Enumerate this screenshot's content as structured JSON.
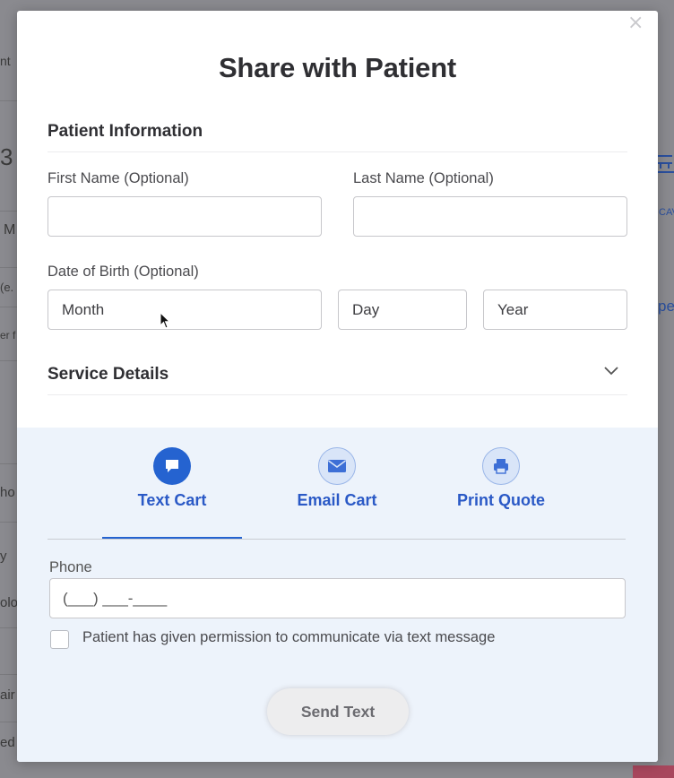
{
  "background": {
    "fragments": [
      "nt",
      "3",
      "M",
      "(e.",
      "er f",
      "ho",
      "y",
      "olo",
      "air",
      "ed",
      "pe",
      "CAV"
    ]
  },
  "modal": {
    "title": "Share with Patient",
    "close_symbol": "×",
    "patient_info": {
      "heading": "Patient Information",
      "first_name": {
        "label": "First Name (Optional)",
        "value": ""
      },
      "last_name": {
        "label": "Last Name (Optional)",
        "value": ""
      },
      "dob": {
        "label": "Date of Birth (Optional)",
        "month": "Month",
        "day": "Day",
        "year": "Year"
      }
    },
    "service_details": {
      "heading": "Service Details",
      "expand_icon": "chevron-down-icon"
    },
    "share": {
      "tabs": [
        {
          "label": "Text Cart",
          "icon": "chat-bubble-icon",
          "active": true
        },
        {
          "label": "Email Cart",
          "icon": "envelope-icon",
          "active": false
        },
        {
          "label": "Print Quote",
          "icon": "printer-icon",
          "active": false
        }
      ],
      "phone": {
        "label": "Phone",
        "mask": "(___) ___-____"
      },
      "consent_label": "Patient has given permission to communicate via text message",
      "consent_checked": false,
      "send_label": "Send Text"
    },
    "colors": {
      "accent": "#2563d0",
      "panel_bg": "#edf3fb",
      "tab_inactive_circle": "#d9e5f8"
    }
  }
}
